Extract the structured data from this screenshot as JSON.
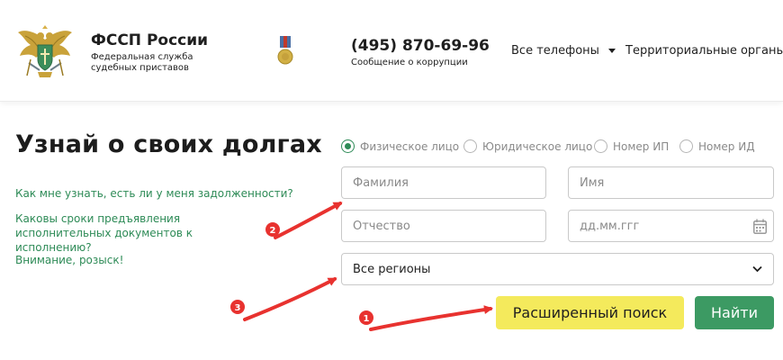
{
  "header": {
    "org_name": "ФССП России",
    "org_subtitle": "Федеральная служба судебных приставов",
    "phone": "(495) 870-69-96",
    "phone_caption": "Сообщение о коррупции",
    "nav": {
      "phones": "Все телефоны",
      "organs": "Территориальные органы"
    }
  },
  "main": {
    "title": "Узнай о своих долгах",
    "links": [
      "Как мне узнать, есть ли у меня задолженности?",
      "Каковы сроки предъявления исполнительных документов к исполнению?",
      "Внимание, розыск!"
    ]
  },
  "search": {
    "search_types": [
      {
        "label": "Физическое лицо",
        "checked": true
      },
      {
        "label": "Юридическое лицо",
        "checked": false
      },
      {
        "label": "Номер ИП",
        "checked": false
      },
      {
        "label": "Номер ИД",
        "checked": false
      }
    ],
    "surname_placeholder": "Фамилия",
    "name_placeholder": "Имя",
    "patronymic_placeholder": "Отчество",
    "date_placeholder": "дд.мм.ггг",
    "region_selected": "Все регионы",
    "advanced_search_label": "Расширенный поиск",
    "find_label": "Найти"
  },
  "annotations": [
    {
      "label": "1"
    },
    {
      "label": "2"
    },
    {
      "label": "3"
    }
  ],
  "colors": {
    "brand_green": "#2e8b57",
    "button_green": "#3c9a63",
    "button_yellow": "#f4ea5c",
    "annotation_red": "#e8322f"
  }
}
